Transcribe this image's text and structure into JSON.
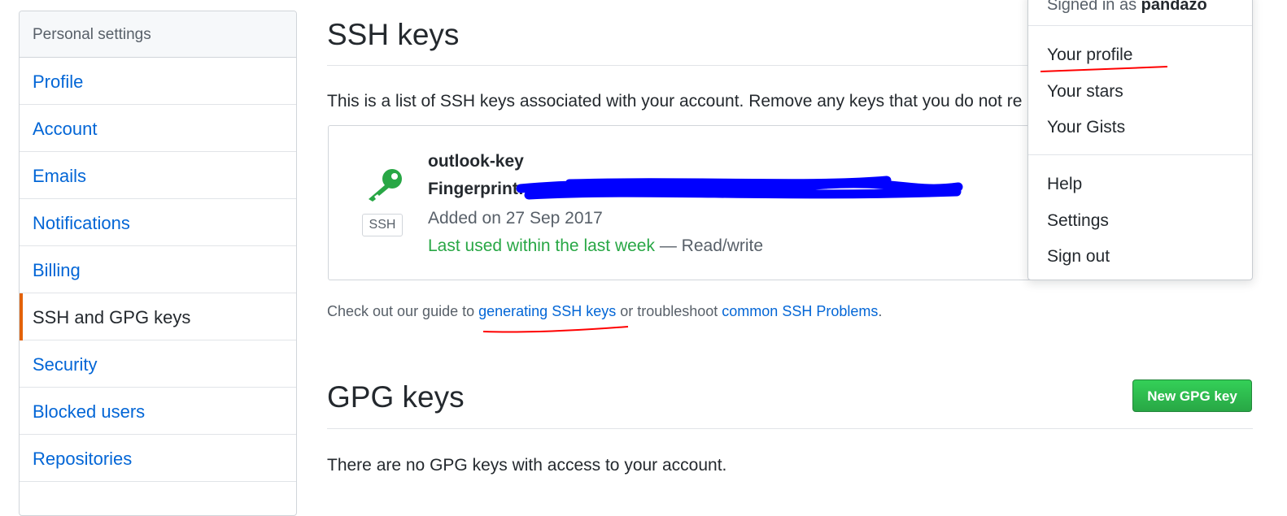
{
  "sidebar": {
    "header": "Personal settings",
    "items": [
      {
        "label": "Profile"
      },
      {
        "label": "Account"
      },
      {
        "label": "Emails"
      },
      {
        "label": "Notifications"
      },
      {
        "label": "Billing"
      },
      {
        "label": "SSH and GPG keys",
        "selected": true
      },
      {
        "label": "Security"
      },
      {
        "label": "Blocked users"
      },
      {
        "label": "Repositories"
      }
    ]
  },
  "ssh": {
    "title": "SSH keys",
    "description": "This is a list of SSH keys associated with your account. Remove any keys that you do not re",
    "key": {
      "icon": "key-icon",
      "badge": "SSH",
      "name": "outlook-key",
      "fingerprint_label": "Fingerprint:",
      "added": "Added on 27 Sep 2017",
      "last_used": "Last used within the last week",
      "access": " — Read/write"
    },
    "guide_prefix": "Check out our guide to ",
    "guide_link1": "generating SSH keys",
    "guide_mid": " or troubleshoot ",
    "guide_link2": "common SSH Problems",
    "guide_suffix": "."
  },
  "gpg": {
    "title": "GPG keys",
    "new_button": "New GPG key",
    "empty_text": "There are no GPG keys with access to your account."
  },
  "user_menu": {
    "signed_in_prefix": "Signed in as ",
    "username": "pandazo",
    "items_group1": [
      "Your profile",
      "Your stars",
      "Your Gists"
    ],
    "items_group2": [
      "Help",
      "Settings",
      "Sign out"
    ]
  },
  "colors": {
    "link": "#0366d6",
    "selected_accent": "#e36209",
    "success_green": "#28a745",
    "annotation_red": "#ff0000",
    "redaction_blue": "#0000ff"
  }
}
